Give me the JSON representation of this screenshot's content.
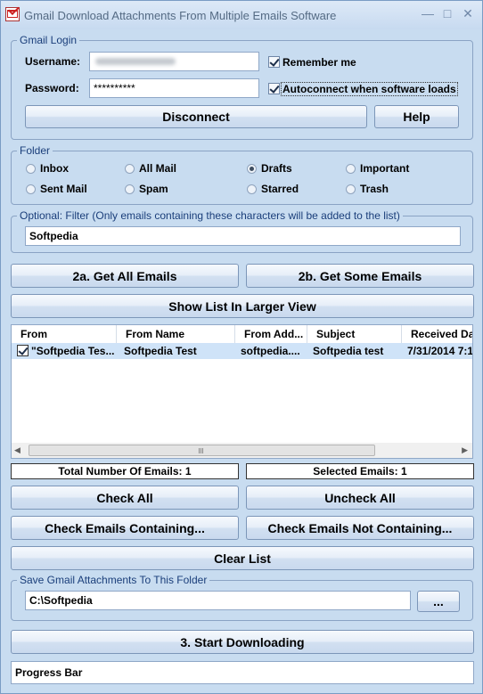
{
  "window": {
    "title": "Gmail Download Attachments From Multiple Emails Software"
  },
  "login": {
    "group_label": "Gmail Login",
    "username_label": "Username:",
    "password_label": "Password:",
    "password_value": "**********",
    "remember_label": "Remember me",
    "remember_checked": true,
    "autoconnect_label": "Autoconnect when software loads",
    "autoconnect_checked": true,
    "disconnect_label": "Disconnect",
    "help_label": "Help"
  },
  "folder": {
    "group_label": "Folder",
    "options": [
      "Inbox",
      "All Mail",
      "Drafts",
      "Important",
      "Sent Mail",
      "Spam",
      "Starred",
      "Trash"
    ],
    "selected": "Drafts"
  },
  "filter": {
    "group_label": "Optional: Filter (Only emails containing these characters will be added to the list)",
    "value": "Softpedia"
  },
  "actions": {
    "get_all": "2a. Get All Emails",
    "get_some": "2b. Get Some Emails",
    "show_larger": "Show List In Larger View"
  },
  "list": {
    "columns": [
      "From",
      "From Name",
      "From Add...",
      "Subject",
      "Received Da"
    ],
    "rows": [
      {
        "checked": true,
        "from": "\"Softpedia Tes...",
        "from_name": "Softpedia Test",
        "from_address": "softpedia....",
        "subject": "Softpedia test",
        "received": "7/31/2014 7:1"
      }
    ]
  },
  "counts": {
    "total_label": "Total Number Of Emails: 1",
    "selected_label": "Selected Emails: 1"
  },
  "buttons": {
    "check_all": "Check All",
    "uncheck_all": "Uncheck All",
    "check_containing": "Check Emails Containing...",
    "check_not_containing": "Check Emails Not Containing...",
    "clear_list": "Clear List"
  },
  "save": {
    "group_label": "Save Gmail Attachments To This Folder",
    "path": "C:\\Softpedia",
    "browse_label": "..."
  },
  "start": {
    "label": "3. Start Downloading"
  },
  "progress": {
    "label": "Progress Bar"
  }
}
